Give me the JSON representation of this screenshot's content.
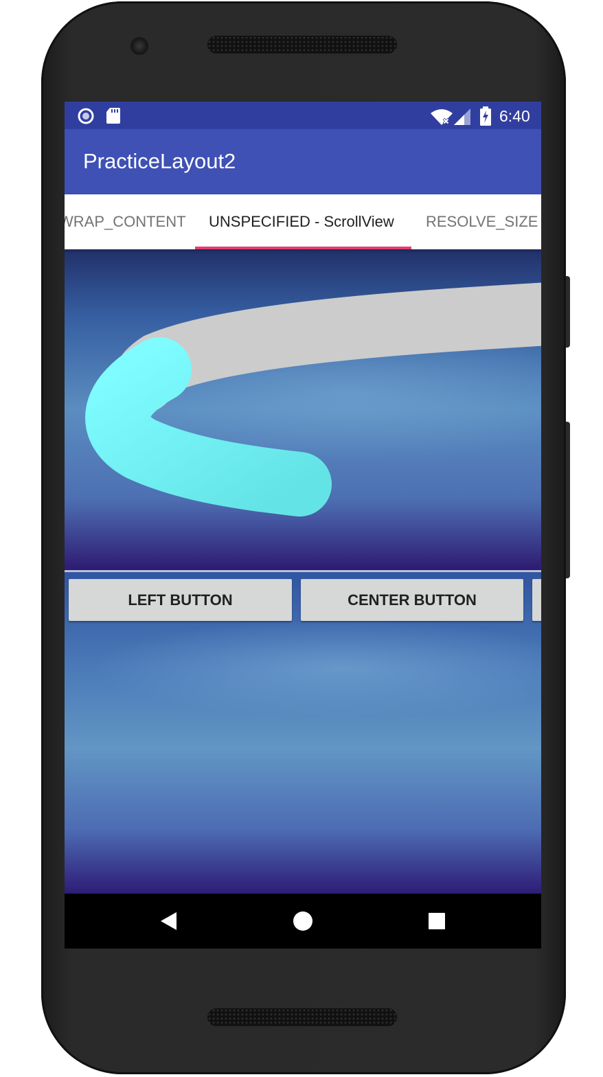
{
  "status_bar": {
    "time": "6:40",
    "left_icons": [
      "circle-notification-icon",
      "sd-card-icon"
    ],
    "right_icons": [
      "wifi-icon",
      "cell-signal-icon",
      "battery-charging-icon"
    ]
  },
  "app_bar": {
    "title": "PracticeLayout2"
  },
  "tabs": [
    {
      "label": "WRAP_CONTENT",
      "selected": false
    },
    {
      "label": "UNSPECIFIED - ScrollView",
      "selected": true
    },
    {
      "label": "RESOLVE_SIZE",
      "selected": false
    }
  ],
  "buttons": {
    "left": "LEFT BUTTON",
    "center": "CENTER BUTTON",
    "right": ""
  },
  "nav_bar": {
    "icons": [
      "back-icon",
      "home-icon",
      "recents-icon"
    ]
  },
  "colors": {
    "status_bar": "#303f9f",
    "app_bar": "#3f51b5",
    "tab_indicator": "#e63d6c",
    "arc_gray": "#cccccc",
    "arc_cyan": "#7ffcff",
    "button": "#d6d7d7"
  }
}
